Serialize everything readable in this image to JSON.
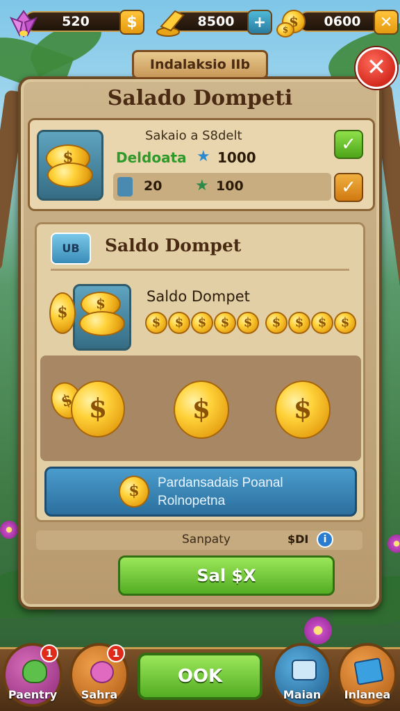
{
  "resources": {
    "gems_value": "520",
    "gold_value": "8500",
    "coins_value": "0600",
    "plus_symbol": "+"
  },
  "title_tag": "Indalaksio IIb",
  "close_symbol": "✕",
  "panel": {
    "title": "Salado Dompeti",
    "summary_box": {
      "heading": "Sakaio a S8delt",
      "label_green": "Deldoata",
      "row1_value": "1000",
      "row2_left_value": "20",
      "row2_value": "100",
      "check_symbol": "✓"
    },
    "wallet": {
      "tag": "UB",
      "heading": "Saldo Dompet",
      "subheading": "Saldo Dompet",
      "coin_symbol": "$",
      "coin_count": 9
    },
    "info_bar": {
      "line1": "Pardansadais Poanal",
      "line2": "Rolnopetna"
    },
    "summary_row": {
      "label": "Sanpaty",
      "value": "$DI",
      "info_icon": "i"
    },
    "action_button": "Sal $X"
  },
  "bottom_nav": {
    "items": [
      {
        "label": "Paentry",
        "badge": "1"
      },
      {
        "label": "Sahra",
        "badge": "1"
      },
      {
        "label": "Maian"
      },
      {
        "label": "Inlanea"
      }
    ],
    "ok_button": "OOK"
  }
}
